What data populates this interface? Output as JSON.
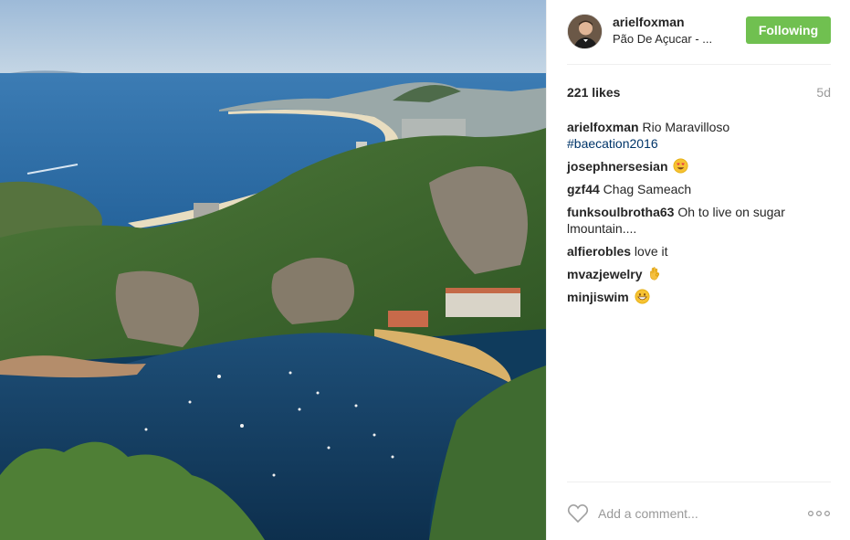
{
  "post": {
    "image_alt_icon": "photo-rio-de-janeiro-aerial",
    "username": "arielfoxman",
    "location": "Pão De Açucar - ...",
    "follow_label": "Following",
    "likes": "221 likes",
    "age": "5d",
    "caption": {
      "author": "arielfoxman",
      "text": " Rio Maravilloso",
      "hashtag": "#baecation2016"
    },
    "comments": [
      {
        "author": "josephnersesian",
        "text": " ",
        "emoji": "heart-eyes"
      },
      {
        "author": "gzf44",
        "text": " Chag Sameach",
        "emoji": ""
      },
      {
        "author": "funksoulbrotha63",
        "text": " Oh to live on sugar lmountain....",
        "emoji": ""
      },
      {
        "author": "alfierobles",
        "text": " love it",
        "emoji": ""
      },
      {
        "author": "mvazjewelry",
        "text": " ",
        "emoji": "ok-hand"
      },
      {
        "author": "minjiswim",
        "text": " ",
        "emoji": "grinning"
      }
    ],
    "comment_placeholder": "Add a comment...",
    "colors": {
      "follow_green": "#70c050",
      "hashtag_blue": "#003569",
      "muted": "#999999"
    }
  }
}
